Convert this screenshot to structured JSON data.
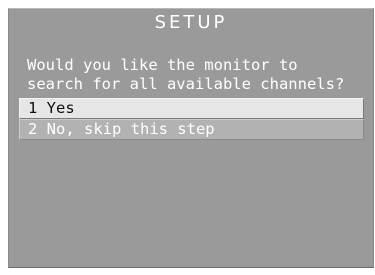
{
  "screen": {
    "title": "SETUP",
    "question_line1": "Would you like the monitor to",
    "question_line2": "search for all available channels?"
  },
  "menu": {
    "options": [
      {
        "label": "1 Yes",
        "selected": true
      },
      {
        "label": "2 No, skip this step",
        "selected": false
      }
    ]
  },
  "colors": {
    "background": "#9a9a9a",
    "text": "#ffffff",
    "selected_bg": "#e6e6e6",
    "selected_text": "#111111",
    "option_bg": "#b2b2b2"
  }
}
